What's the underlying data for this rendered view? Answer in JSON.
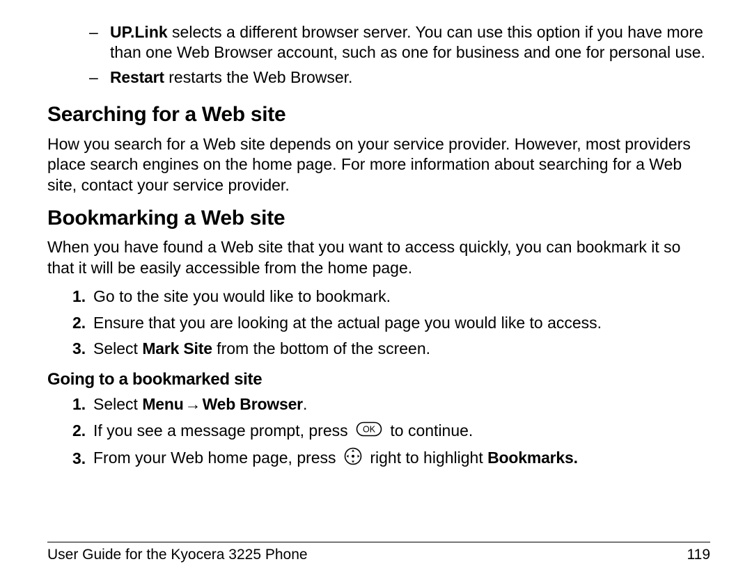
{
  "dash_items": [
    {
      "bold": "UP.Link",
      "rest": " selects a different browser server. You can use this option if you have more than one Web Browser account, such as one for business and one for personal use."
    },
    {
      "bold": "Restart",
      "rest": " restarts the Web Browser."
    }
  ],
  "section1": {
    "title": "Searching for a Web site",
    "body": "How you search for a Web site depends on your service provider. However, most providers place search engines on the home page. For more information about searching for a Web site, contact your service provider."
  },
  "section2": {
    "title": "Bookmarking a Web site",
    "body": "When you have found a Web site that you want to access quickly, you can bookmark it so that it will be easily accessible from the home page.",
    "steps": [
      {
        "n": "1.",
        "text": "Go to the site you would like to bookmark."
      },
      {
        "n": "2.",
        "text": "Ensure that you are looking at the actual page you would like to access."
      },
      {
        "n": "3.",
        "pre": "Select ",
        "bold": "Mark Site",
        "post": " from the bottom of the screen."
      }
    ]
  },
  "section3": {
    "title": "Going to a bookmarked site",
    "steps": [
      {
        "n": "1.",
        "pre": "Select ",
        "bold1": "Menu",
        "arrow": " → ",
        "bold2": "Web Browser",
        "post": "."
      },
      {
        "n": "2.",
        "pre": "If you see a message prompt, press ",
        "icon": "ok",
        "post": " to continue."
      },
      {
        "n": "3.",
        "pre": "From your Web home page, press ",
        "icon": "nav",
        "post_pre": " right to highlight ",
        "bold": "Bookmarks."
      }
    ]
  },
  "footer": {
    "left": "User Guide for the Kyocera 3225 Phone",
    "right": "119"
  }
}
